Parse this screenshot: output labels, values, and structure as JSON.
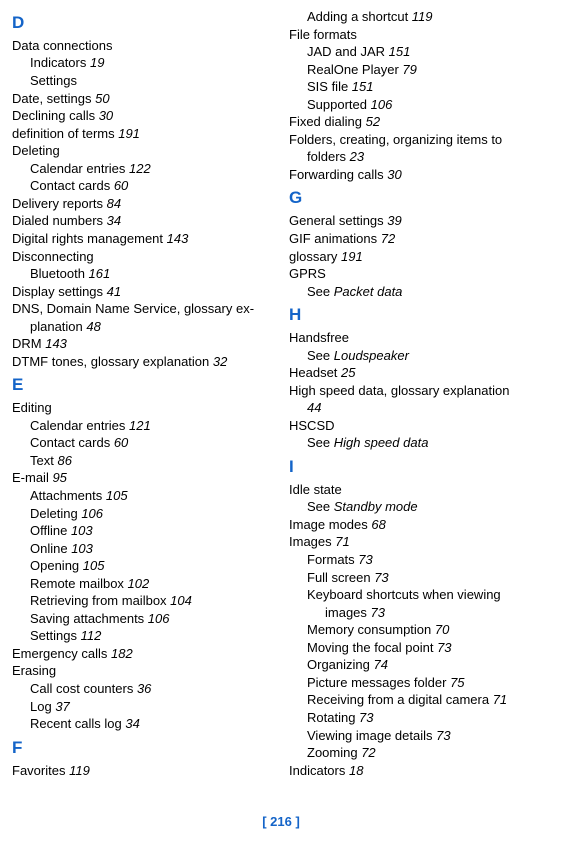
{
  "footer": "[ 216 ]",
  "col1": [
    {
      "type": "letter",
      "text": "D"
    },
    {
      "type": "entry",
      "text": "Data connections"
    },
    {
      "type": "sub",
      "label": "Indicators",
      "page": "19"
    },
    {
      "type": "subtext",
      "text": "Settings"
    },
    {
      "type": "entry",
      "text": "Date, settings",
      "page": "50"
    },
    {
      "type": "entry",
      "text": "Declining calls",
      "page": "30"
    },
    {
      "type": "entry",
      "text": "definition of terms",
      "page": "191"
    },
    {
      "type": "entry",
      "text": "Deleting"
    },
    {
      "type": "sub",
      "label": "Calendar entries",
      "page": "122"
    },
    {
      "type": "sub",
      "label": "Contact cards",
      "page": "60"
    },
    {
      "type": "entry",
      "text": "Delivery reports",
      "page": "84"
    },
    {
      "type": "entry",
      "text": "Dialed numbers",
      "page": "34"
    },
    {
      "type": "entry",
      "text": "Digital rights management",
      "page": "143"
    },
    {
      "type": "entry",
      "text": "Disconnecting"
    },
    {
      "type": "sub",
      "label": "Bluetooth",
      "page": "161"
    },
    {
      "type": "entry",
      "text": "Display settings",
      "page": "41"
    },
    {
      "type": "hang",
      "pre": "DNS, Domain Name Service, glossary ex-",
      "cont": "planation",
      "page": "48"
    },
    {
      "type": "entry",
      "text": "DRM",
      "page": "143"
    },
    {
      "type": "entry",
      "text": "DTMF tones, glossary explanation",
      "page": "32"
    },
    {
      "type": "letter",
      "text": "E"
    },
    {
      "type": "entry",
      "text": "Editing"
    },
    {
      "type": "sub",
      "label": "Calendar entries",
      "page": "121"
    },
    {
      "type": "sub",
      "label": "Contact cards",
      "page": "60"
    },
    {
      "type": "sub",
      "label": "Text",
      "page": "86"
    },
    {
      "type": "entry",
      "text": "E-mail",
      "page": "95"
    },
    {
      "type": "sub",
      "label": "Attachments",
      "page": "105"
    },
    {
      "type": "sub",
      "label": "Deleting",
      "page": "106"
    },
    {
      "type": "sub",
      "label": "Offline",
      "page": "103"
    },
    {
      "type": "sub",
      "label": "Online",
      "page": "103"
    },
    {
      "type": "sub",
      "label": "Opening",
      "page": "105"
    },
    {
      "type": "sub",
      "label": "Remote mailbox",
      "page": "102"
    },
    {
      "type": "sub",
      "label": "Retrieving from mailbox",
      "page": "104"
    },
    {
      "type": "sub",
      "label": "Saving attachments",
      "page": "106"
    },
    {
      "type": "sub",
      "label": "Settings",
      "page": "112"
    },
    {
      "type": "entry",
      "text": "Emergency calls",
      "page": "182"
    },
    {
      "type": "entry",
      "text": "Erasing"
    },
    {
      "type": "sub",
      "label": "Call cost counters",
      "page": "36"
    },
    {
      "type": "sub",
      "label": "Log",
      "page": "37"
    },
    {
      "type": "sub",
      "label": "Recent calls log",
      "page": "34"
    },
    {
      "type": "letter",
      "text": "F"
    },
    {
      "type": "entry",
      "text": "Favorites",
      "page": "119"
    }
  ],
  "col2": [
    {
      "type": "sub",
      "label": "Adding a shortcut",
      "page": "119"
    },
    {
      "type": "entry",
      "text": "File formats"
    },
    {
      "type": "sub",
      "label": "JAD and JAR",
      "page": "151"
    },
    {
      "type": "sub",
      "label": "RealOne Player",
      "page": "79"
    },
    {
      "type": "sub",
      "label": "SIS file",
      "page": "151"
    },
    {
      "type": "sub",
      "label": "Supported",
      "page": "106"
    },
    {
      "type": "entry",
      "text": "Fixed dialing",
      "page": "52"
    },
    {
      "type": "hangj",
      "pre": "Folders, creating, organizing items to",
      "cont": "folders",
      "page": "23"
    },
    {
      "type": "entry",
      "text": "Forwarding calls",
      "page": "30"
    },
    {
      "type": "letter",
      "text": "G"
    },
    {
      "type": "entry",
      "text": "General settings",
      "page": "39"
    },
    {
      "type": "entry",
      "text": "GIF animations",
      "page": "72"
    },
    {
      "type": "entry",
      "text": "glossary",
      "page": "191"
    },
    {
      "type": "entry",
      "text": "GPRS"
    },
    {
      "type": "subxref",
      "pre": "See",
      "xref": "Packet data"
    },
    {
      "type": "letter",
      "text": "H"
    },
    {
      "type": "entry",
      "text": "Handsfree"
    },
    {
      "type": "subxref",
      "pre": "See",
      "xref": "Loudspeaker"
    },
    {
      "type": "entry",
      "text": "Headset",
      "page": "25"
    },
    {
      "type": "hangj",
      "pre": "High speed data, glossary explanation",
      "cont": "",
      "page": "44"
    },
    {
      "type": "entry",
      "text": "HSCSD"
    },
    {
      "type": "subxref",
      "pre": "See",
      "xref": "High speed data"
    },
    {
      "type": "letter",
      "text": "I"
    },
    {
      "type": "entry",
      "text": "Idle state"
    },
    {
      "type": "subxref",
      "pre": "See",
      "xref": "Standby mode"
    },
    {
      "type": "entry",
      "text": "Image modes",
      "page": "68"
    },
    {
      "type": "entry",
      "text": "Images",
      "page": "71"
    },
    {
      "type": "sub",
      "label": "Formats",
      "page": "73"
    },
    {
      "type": "sub",
      "label": "Full screen",
      "page": "73"
    },
    {
      "type": "subhang",
      "pre": "Keyboard shortcuts when viewing",
      "cont": "images",
      "page": "73"
    },
    {
      "type": "sub",
      "label": "Memory consumption",
      "page": "70"
    },
    {
      "type": "sub",
      "label": "Moving the focal point",
      "page": "73"
    },
    {
      "type": "sub",
      "label": "Organizing",
      "page": "74"
    },
    {
      "type": "sub",
      "label": "Picture messages folder",
      "page": "75"
    },
    {
      "type": "sub",
      "label": "Receiving from a digital camera",
      "page": "71"
    },
    {
      "type": "sub",
      "label": "Rotating",
      "page": "73"
    },
    {
      "type": "sub",
      "label": "Viewing image details",
      "page": "73"
    },
    {
      "type": "sub",
      "label": "Zooming",
      "page": "72"
    },
    {
      "type": "entry",
      "text": "Indicators",
      "page": "18"
    }
  ]
}
